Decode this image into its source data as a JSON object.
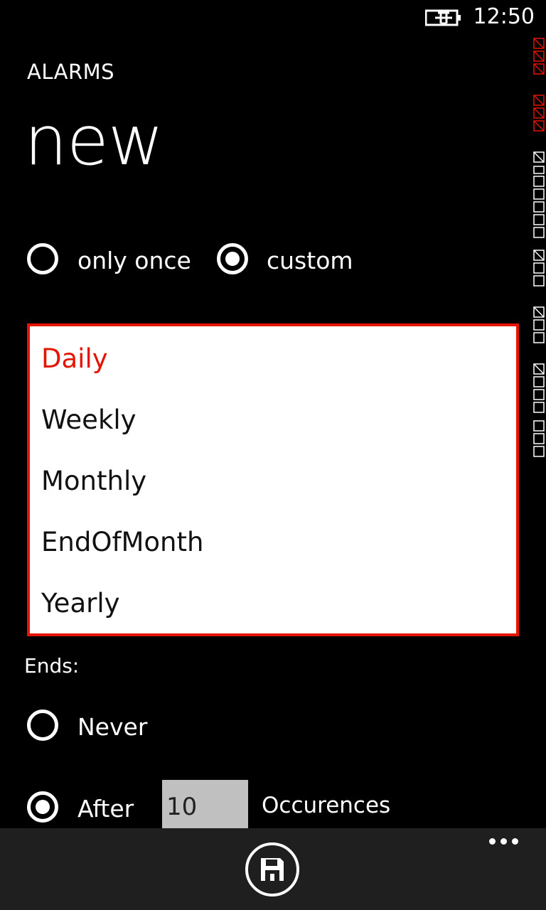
{
  "status": {
    "time": "12:50"
  },
  "header": {
    "app_title": "ALARMS",
    "page_title": "new"
  },
  "repeat": {
    "only_once_label": "only once",
    "custom_label": "custom",
    "selected": "custom"
  },
  "frequency": {
    "items": [
      "Daily",
      "Weekly",
      "Monthly",
      "EndOfMonth",
      "Yearly"
    ],
    "selected": "Daily"
  },
  "ends": {
    "label": "Ends:",
    "never_label": "Never",
    "after_label": "After",
    "occurrences_value": "10",
    "occurrences_label": "Occurences",
    "selected": "After"
  },
  "colors": {
    "accent": "#e51400",
    "background": "#000000",
    "app_bar": "#1f1f1f"
  }
}
